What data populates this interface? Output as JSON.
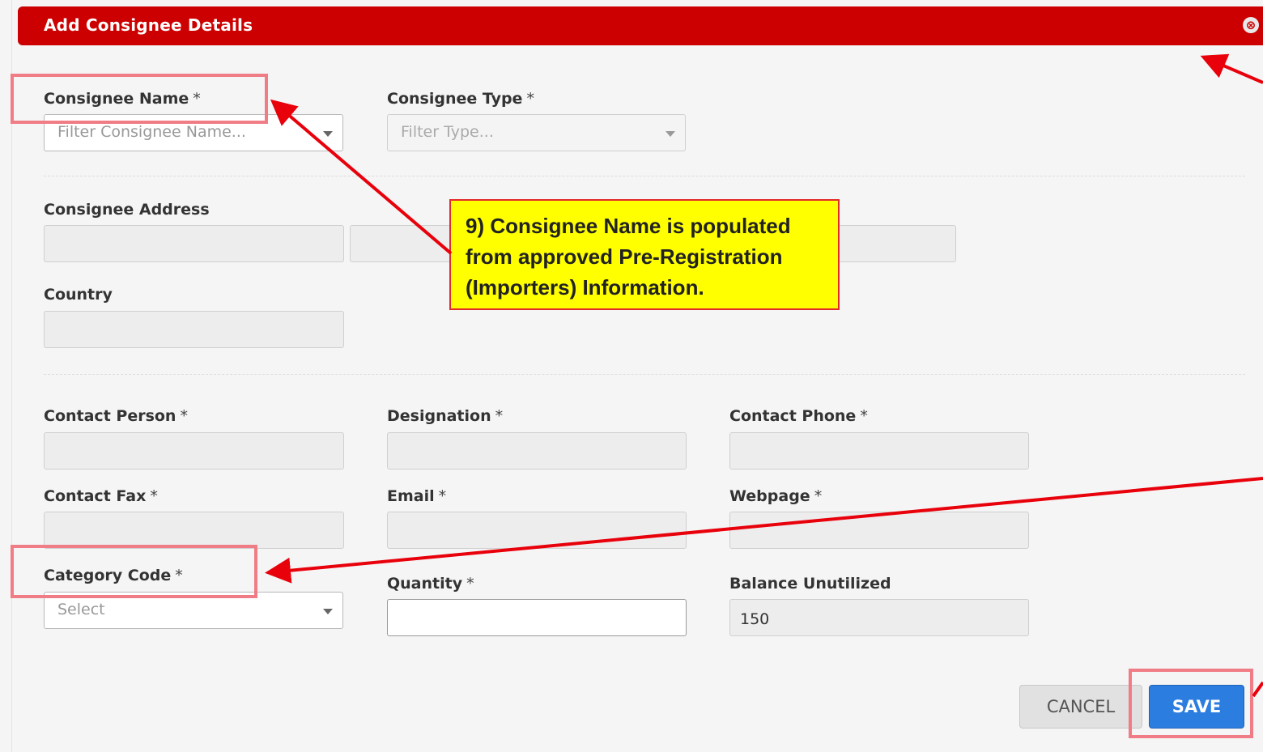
{
  "modal": {
    "title": "Add Consignee Details"
  },
  "fields": {
    "consignee_name": {
      "label": "Consignee Name",
      "required": "*",
      "placeholder": "Filter Consignee Name..."
    },
    "consignee_type": {
      "label": "Consignee Type",
      "required": "*",
      "placeholder": "Filter Type..."
    },
    "consignee_address": {
      "label": "Consignee Address"
    },
    "country": {
      "label": "Country"
    },
    "contact_person": {
      "label": "Contact Person",
      "required": "*"
    },
    "designation": {
      "label": "Designation",
      "required": "*"
    },
    "contact_phone": {
      "label": "Contact Phone",
      "required": "*"
    },
    "contact_fax": {
      "label": "Contact Fax",
      "required": "*"
    },
    "email": {
      "label": "Email",
      "required": "*"
    },
    "webpage": {
      "label": "Webpage",
      "required": "*"
    },
    "category_code": {
      "label": "Category Code",
      "required": "*",
      "placeholder": "Select"
    },
    "quantity": {
      "label": "Quantity",
      "required": "*",
      "value": ""
    },
    "balance_unutilized": {
      "label": "Balance Unutilized",
      "value": "150"
    }
  },
  "annotation": {
    "text": "9) Consignee Name is populated from approved Pre-Registration (Importers) Information."
  },
  "buttons": {
    "cancel": "CANCEL",
    "save": "SAVE"
  },
  "colors": {
    "header": "#cc0000",
    "save": "#2c7de0",
    "callout_bg": "#ffff00",
    "arrow": "#e8000b",
    "highlight": "#f07d86"
  }
}
